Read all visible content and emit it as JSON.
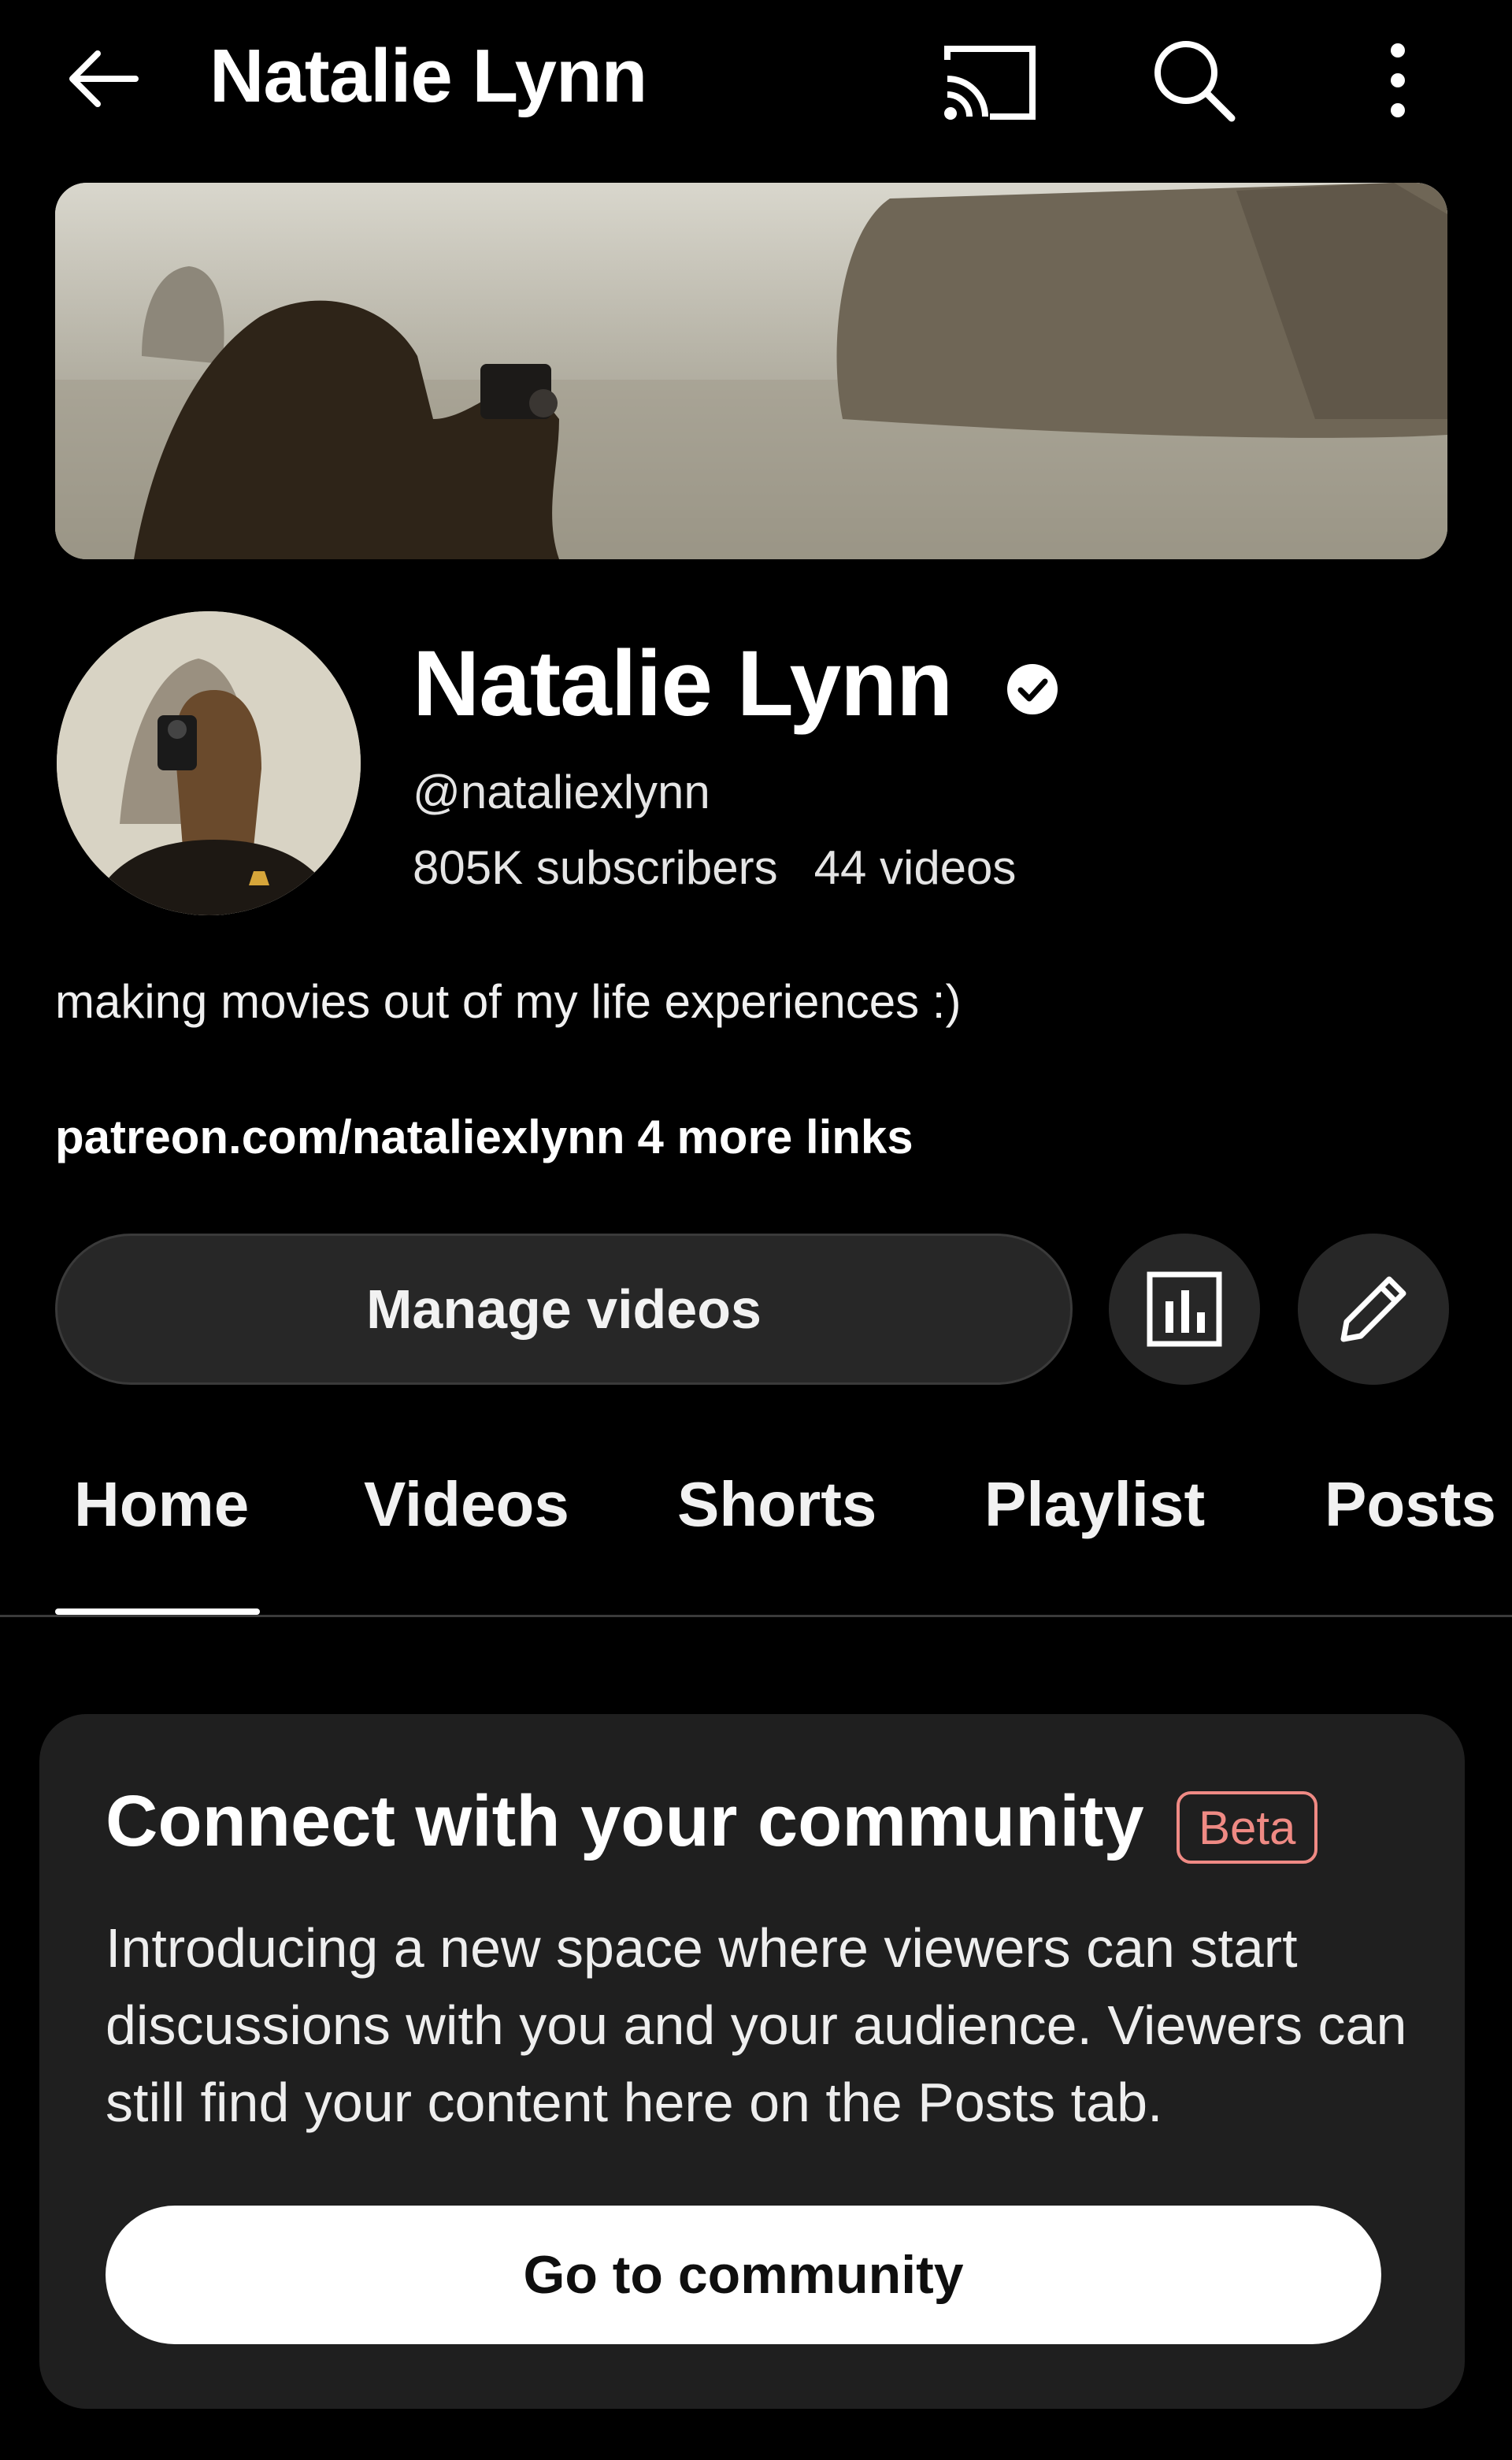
{
  "topbar": {
    "title": "Natalie Lynn",
    "back_icon": "arrow-left-icon",
    "cast_icon": "cast-icon",
    "search_icon": "search-icon",
    "more_icon": "more-vertical-icon"
  },
  "channel": {
    "name": "Natalie Lynn",
    "verified_icon": "verified-check-icon",
    "handle": "@nataliexlynn",
    "subscribers": "805K subscribers",
    "videos": "44 videos",
    "description": "making movies out of my life experiences :)",
    "link": "patreon.com/nataliexlynn",
    "more_links": "4 more links"
  },
  "actions": {
    "manage_label": "Manage videos",
    "analytics_icon": "analytics-icon",
    "edit_icon": "pencil-icon"
  },
  "tabs": [
    {
      "label": "Home",
      "selected": true
    },
    {
      "label": "Videos"
    },
    {
      "label": "Shorts"
    },
    {
      "label": "Playlist"
    },
    {
      "label": "Posts"
    }
  ],
  "community_card": {
    "title": "Connect with your community",
    "badge": "Beta",
    "body": "Introducing a new space where viewers can start discussions with you and your audience. Viewers can still find your content here on the Posts tab.",
    "button_label": "Go to community"
  },
  "colors": {
    "background": "#000000",
    "card": "#1f1f1f",
    "button": "#272727",
    "beta": "#ef8a84"
  }
}
